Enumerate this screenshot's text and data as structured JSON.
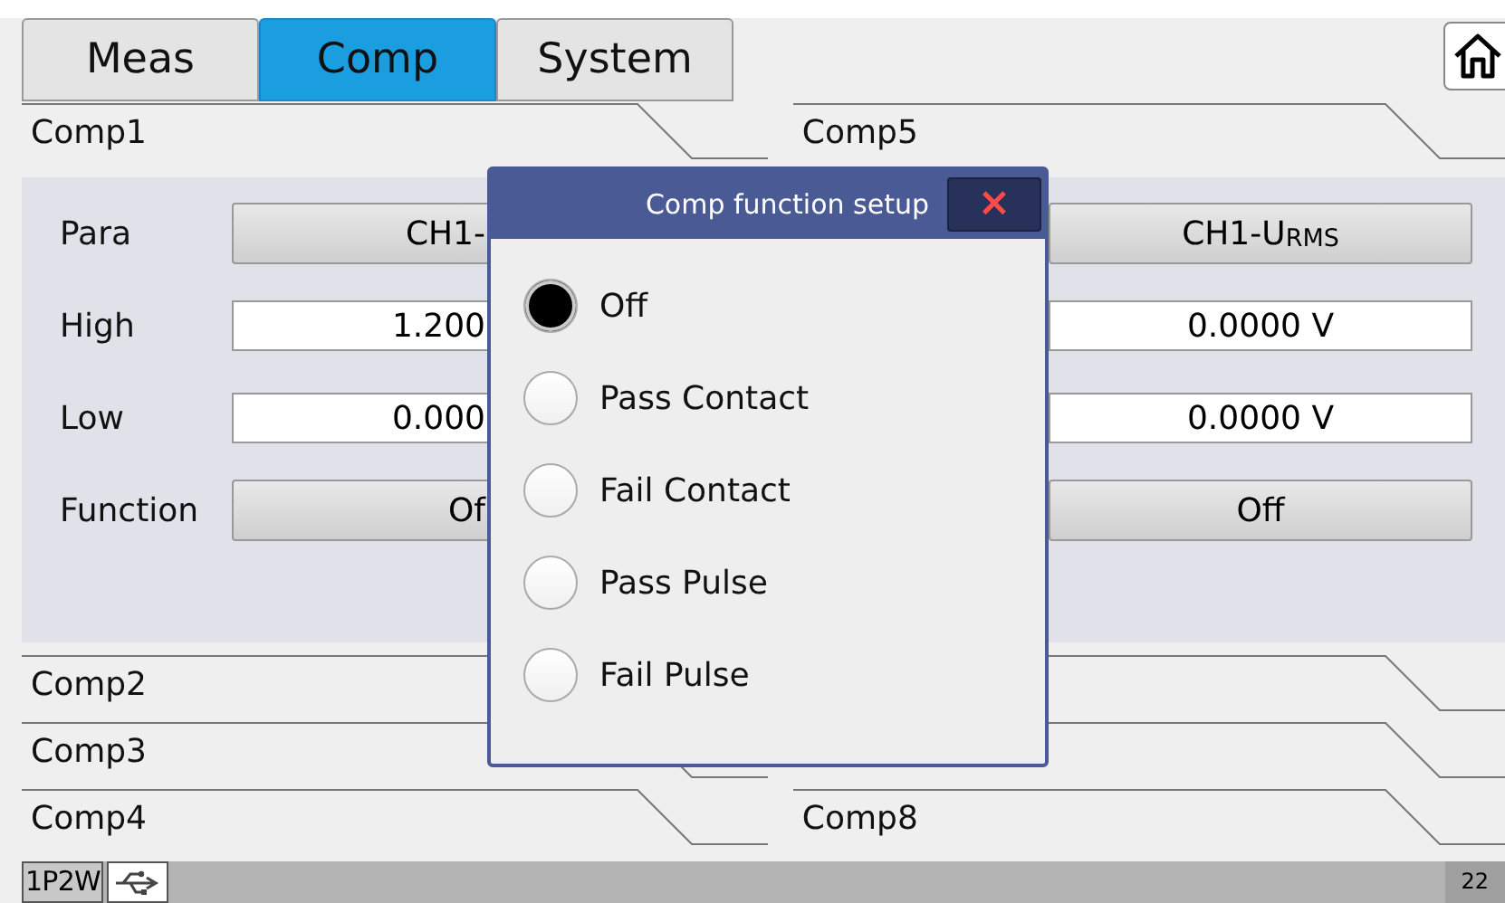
{
  "tabs": [
    {
      "label": "Meas",
      "selected": false
    },
    {
      "label": "Comp",
      "selected": true
    },
    {
      "label": "System",
      "selected": false
    }
  ],
  "comp_headers": {
    "left": "Comp1",
    "right": "Comp5"
  },
  "panel": {
    "labels": [
      "Para",
      "High",
      "Low",
      "Function"
    ],
    "left_values": [
      {
        "kind": "button",
        "value": "CH1-"
      },
      {
        "kind": "field",
        "value": "1.200"
      },
      {
        "kind": "field",
        "value": "0.000"
      },
      {
        "kind": "button",
        "value": "Of"
      }
    ],
    "right_values": [
      {
        "kind": "button",
        "value": "CH1-U$_{RMS}$"
      },
      {
        "kind": "field",
        "value": "0.0000 V"
      },
      {
        "kind": "field",
        "value": "0.0000 V"
      },
      {
        "kind": "button",
        "value": "Off"
      }
    ]
  },
  "lower_rows": [
    {
      "left": "Comp2"
    },
    {
      "left": "Comp3"
    },
    {
      "left": "Comp4",
      "right": "Comp8"
    }
  ],
  "dialog": {
    "title": "Comp function setup",
    "close": "×",
    "options": [
      {
        "label": "Off",
        "selected": true
      },
      {
        "label": "Pass Contact",
        "selected": false
      },
      {
        "label": "Fail Contact",
        "selected": false
      },
      {
        "label": "Pass Pulse",
        "selected": false
      },
      {
        "label": "Fail Pulse",
        "selected": false
      }
    ]
  },
  "status_bar": {
    "mode": "1P2W",
    "number": "22"
  }
}
